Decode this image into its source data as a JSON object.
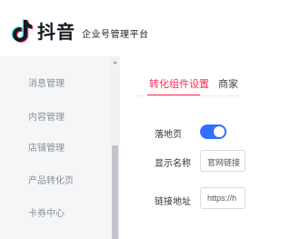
{
  "header": {
    "app_name": "抖音",
    "subtitle": "企业号管理平台"
  },
  "sidebar": {
    "items": [
      {
        "label": "消息管理"
      },
      {
        "label": "内容管理"
      },
      {
        "label": "店铺管理"
      },
      {
        "label": "产品转化页"
      },
      {
        "label": "卡券中心"
      }
    ]
  },
  "tabs": [
    {
      "label": "转化组件设置",
      "active": true
    },
    {
      "label": "商家",
      "active": false
    }
  ],
  "form": {
    "landing_page": {
      "label": "落地页",
      "enabled": true
    },
    "display_name": {
      "label": "显示名称",
      "value": "官网链接"
    },
    "link_url": {
      "label": "链接地址",
      "value": "https://h"
    }
  },
  "colors": {
    "accent": "#fe2c55",
    "toggle_on": "#3370ff",
    "sidebar_bg": "#f5f6f7"
  }
}
